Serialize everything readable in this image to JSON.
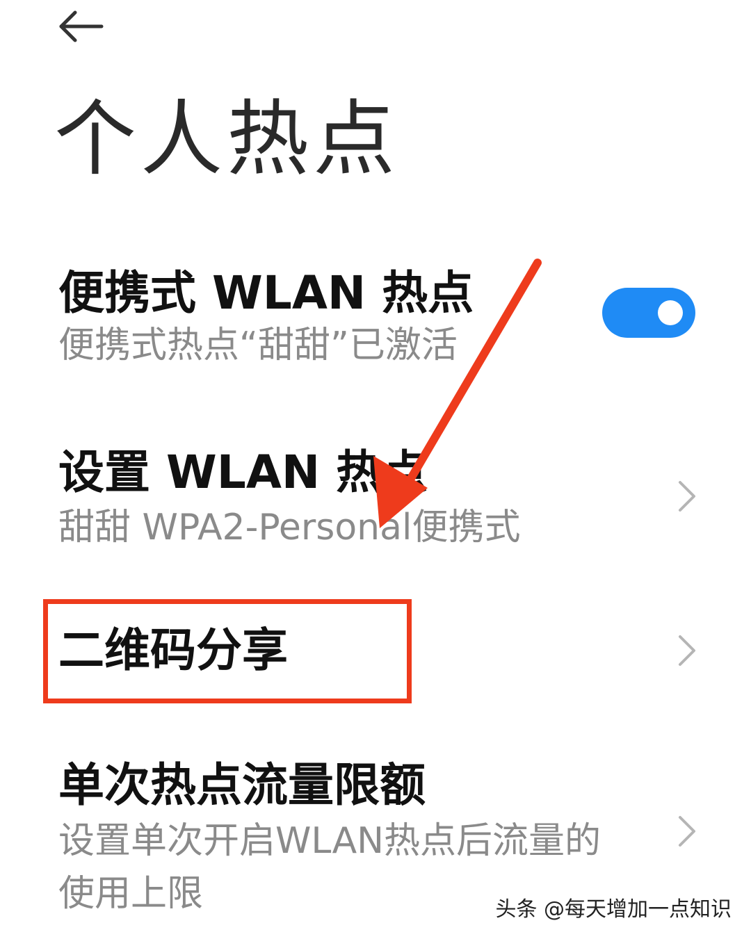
{
  "header": {
    "back_icon": "arrow-left-icon",
    "title": "个人热点"
  },
  "settings": {
    "portable_hotspot": {
      "title": "便携式 WLAN 热点",
      "subtitle": "便携式热点“甜甜”已激活",
      "enabled": true,
      "toggle_color": "#1f8bf5"
    },
    "configure_hotspot": {
      "title": "设置 WLAN 热点",
      "subtitle": "甜甜 WPA2-Personal便携式",
      "chevron_icon": "chevron-right-icon"
    },
    "qr_share": {
      "title": "二维码分享",
      "chevron_icon": "chevron-right-icon"
    },
    "data_limit": {
      "title": "单次热点流量限额",
      "subtitle": "设置单次开启WLAN热点后流量的使用上限",
      "chevron_icon": "chevron-right-icon"
    }
  },
  "annotations": {
    "arrow_color": "#ee3b1c",
    "box_color": "#ee3b1c"
  },
  "watermark": "头条 @每天增加一点知识"
}
